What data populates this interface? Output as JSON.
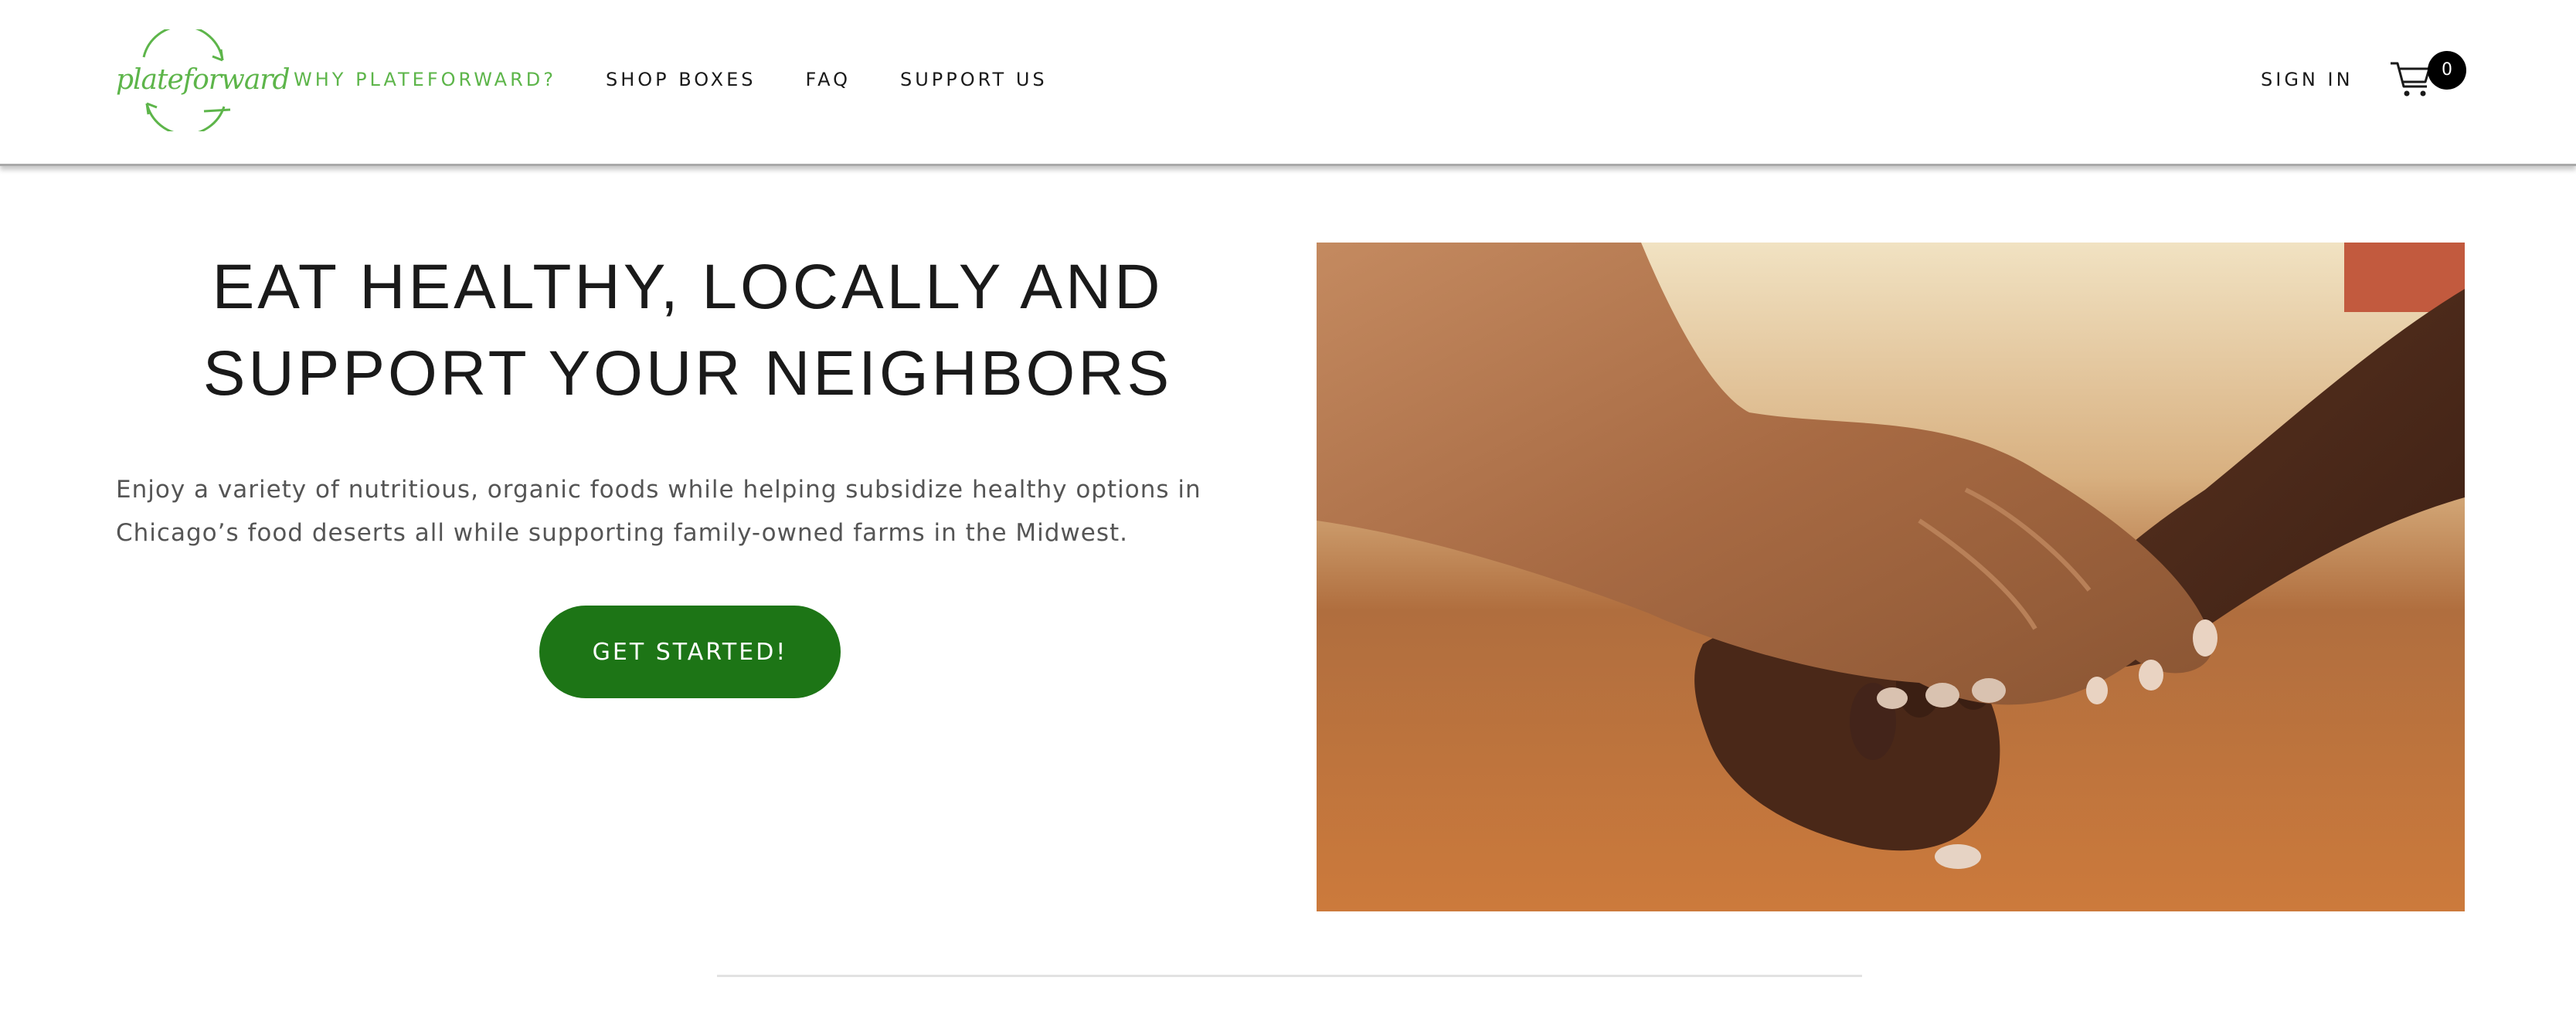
{
  "brand": {
    "logo_text": "plateforward",
    "accent_color": "#5db54a",
    "button_color": "#1d7516"
  },
  "nav": {
    "items": [
      {
        "label": "WHY PLATEFORWARD?",
        "active": true
      },
      {
        "label": "SHOP BOXES",
        "active": false
      },
      {
        "label": "FAQ",
        "active": false
      },
      {
        "label": "SUPPORT US",
        "active": false
      }
    ],
    "sign_in": "SIGN IN",
    "cart_icon": "cart-icon",
    "cart_count": "0"
  },
  "hero": {
    "title_line1": "EAT HEALTHY, LOCALLY AND",
    "title_line2": "SUPPORT YOUR NEIGHBORS",
    "body_line1": "Enjoy a variety of nutritious, organic foods while helping subsidize healthy options in",
    "body_line2": "Chicago’s food deserts all while supporting family-owned farms in the Midwest.",
    "cta_label": "GET STARTED!",
    "image_subject": "hands-holding-photo"
  }
}
